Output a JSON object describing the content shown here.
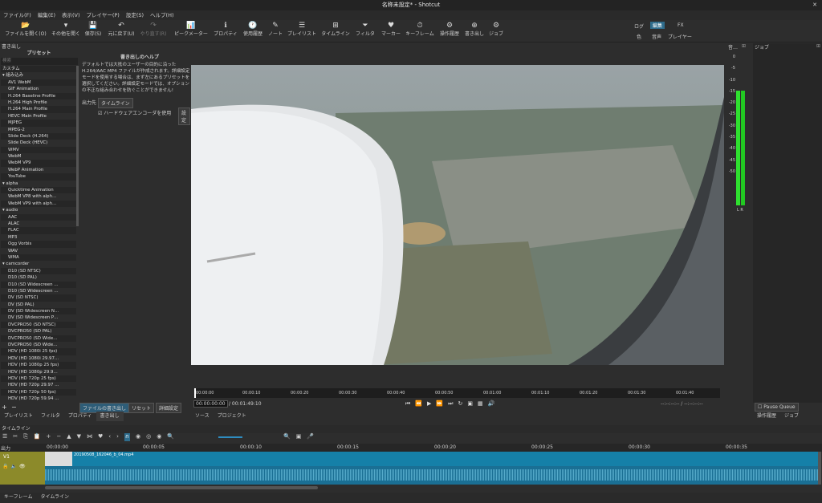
{
  "window": {
    "title": "名称未設定* - Shotcut",
    "close": "✕"
  },
  "menu": [
    "ファイル(F)",
    "編集(E)",
    "表示(V)",
    "プレイヤー(P)",
    "設定(S)",
    "ヘルプ(H)"
  ],
  "toolbar": [
    {
      "label": "ファイルを開く(O)",
      "icon": "📂"
    },
    {
      "label": "その他を開く",
      "icon": "▾"
    },
    {
      "label": "保存(S)",
      "icon": "💾"
    },
    {
      "label": "元に戻す(U)",
      "icon": "↶"
    },
    {
      "label": "やり直す(R)",
      "icon": "↷"
    },
    {
      "label": "ピークメーター",
      "icon": "📊"
    },
    {
      "label": "プロパティ",
      "icon": "ℹ"
    },
    {
      "label": "使用履歴",
      "icon": "🕐"
    },
    {
      "label": "ノート",
      "icon": "✎"
    },
    {
      "label": "プレイリスト",
      "icon": "☰"
    },
    {
      "label": "タイムライン",
      "icon": "⊞"
    },
    {
      "label": "フィルタ",
      "icon": "⏷"
    },
    {
      "label": "マーカー",
      "icon": "♥"
    },
    {
      "label": "キーフレーム",
      "icon": "⏱"
    },
    {
      "label": "操作履歴",
      "icon": "⚙"
    },
    {
      "label": "書き出し",
      "icon": "⊕"
    },
    {
      "label": "ジョブ",
      "icon": "⚙"
    }
  ],
  "layouts": {
    "log": "ログ",
    "edit": "編集",
    "fx": "FX",
    "color": "色",
    "audio": "音声",
    "player": "プレイヤー"
  },
  "export": {
    "panel_title": "書き出し",
    "undock": "⊞",
    "presets_header": "プリセット",
    "search_placeholder": "検索",
    "presets": [
      {
        "label": "カスタム",
        "level": 0
      },
      {
        "label": "▾ 組み込み",
        "level": 0
      },
      {
        "label": "AV1 WebM",
        "level": 1
      },
      {
        "label": "GIF Animation",
        "level": 1
      },
      {
        "label": "H.264 Baseline Profile",
        "level": 1
      },
      {
        "label": "H.264 High Profile",
        "level": 1
      },
      {
        "label": "H.264 Main Profile",
        "level": 1
      },
      {
        "label": "HEVC Main Profile",
        "level": 1
      },
      {
        "label": "MJPEG",
        "level": 1
      },
      {
        "label": "MPEG-2",
        "level": 1
      },
      {
        "label": "Slide Deck (H.264)",
        "level": 1
      },
      {
        "label": "Slide Deck (HEVC)",
        "level": 1
      },
      {
        "label": "WMV",
        "level": 1
      },
      {
        "label": "WebM",
        "level": 1
      },
      {
        "label": "WebM VP9",
        "level": 1
      },
      {
        "label": "WebP Animation",
        "level": 1
      },
      {
        "label": "YouTube",
        "level": 1
      },
      {
        "label": "▾ alpha",
        "level": 0
      },
      {
        "label": "Quicktime Animation",
        "level": 1
      },
      {
        "label": "WebM VP8 with alph…",
        "level": 1
      },
      {
        "label": "WebM VP9 with alph…",
        "level": 1
      },
      {
        "label": "▾ audio",
        "level": 0
      },
      {
        "label": "AAC",
        "level": 1
      },
      {
        "label": "ALAC",
        "level": 1
      },
      {
        "label": "FLAC",
        "level": 1
      },
      {
        "label": "MP3",
        "level": 1
      },
      {
        "label": "Ogg Vorbis",
        "level": 1
      },
      {
        "label": "WAV",
        "level": 1
      },
      {
        "label": "WMA",
        "level": 1
      },
      {
        "label": "▾ camcorder",
        "level": 0
      },
      {
        "label": "D10 (SD NTSC)",
        "level": 1
      },
      {
        "label": "D10 (SD PAL)",
        "level": 1
      },
      {
        "label": "D10 (SD Widescreen …",
        "level": 1
      },
      {
        "label": "D10 (SD Widescreen …",
        "level": 1
      },
      {
        "label": "DV (SD NTSC)",
        "level": 1
      },
      {
        "label": "DV (SD PAL)",
        "level": 1
      },
      {
        "label": "DV (SD Widescreen N…",
        "level": 1
      },
      {
        "label": "DV (SD Widescreen P…",
        "level": 1
      },
      {
        "label": "DVCPRO50 (SD NTSC)",
        "level": 1
      },
      {
        "label": "DVCPRO50 (SD PAL)",
        "level": 1
      },
      {
        "label": "DVCPRO50 (SD Wide…",
        "level": 1
      },
      {
        "label": "DVCPRO50 (SD Wide…",
        "level": 1
      },
      {
        "label": "HDV (HD 1080i 25 fps)",
        "level": 1
      },
      {
        "label": "HDV (HD 1080i 29.97…",
        "level": 1
      },
      {
        "label": "HDV (HD 1080p 25 fps)",
        "level": 1
      },
      {
        "label": "HDV (HD 1080p 29.9…",
        "level": 1
      },
      {
        "label": "HDV (HD 720p 25 fps)",
        "level": 1
      },
      {
        "label": "HDV (HD 720p 29.97 …",
        "level": 1
      },
      {
        "label": "HDV (HD 720p 50 fps)",
        "level": 1
      },
      {
        "label": "HDV (HD 720p 59.94 …",
        "level": 1
      }
    ],
    "add": "+",
    "remove": "−",
    "help_title": "書き出しのヘルプ",
    "help_text": "デフォルトでは大抵のユーザーの目的に沿った H.264/AAC MP4 ファイルが作成されます。詳細設定 モードを使用する場合は、まず左にあるプリセットを選択してください。詳細設定モードでは、オプションの不正な組み合わせを防ぐことができません!",
    "output_label": "出力先",
    "output_value": "タイムライン",
    "hw_encoder_label": "ハードウェアエンコーダを使用",
    "hw_config": "設定",
    "export_file_btn": "ファイルの書き出し",
    "reset_btn": "リセット",
    "advanced_btn": "詳細設定"
  },
  "left_tabs": [
    "プレイリスト",
    "フィルタ",
    "プロパティ",
    "書き出し"
  ],
  "player": {
    "ruler": [
      "00:00:00",
      "00:00:10",
      "00:00:20",
      "00:00:30",
      "00:00:40",
      "00:00:50",
      "00:01:00",
      "00:01:10",
      "00:01:20",
      "00:01:30",
      "00:01:40"
    ],
    "timecode": "00:00:00:00",
    "duration": "/ 00:01:49:10",
    "in_out": "--:--:--:-- / --:--:--:--",
    "tabs": [
      "ソース",
      "プロジェクト"
    ]
  },
  "meter": {
    "title": "音…",
    "undock": "⊞",
    "scale": [
      "0",
      "-5",
      "-10",
      "-15",
      "-20",
      "-25",
      "-30",
      "-35",
      "-40",
      "-45",
      "-50"
    ],
    "lr": "L R"
  },
  "jobs": {
    "title": "ジョブ",
    "undock": "⊞",
    "pause_label": "Pause Queue",
    "tabs": [
      "操作履歴",
      "ジョブ"
    ]
  },
  "timeline": {
    "title": "タイムライン",
    "ruler": [
      "00:00:00",
      "00:00:05",
      "00:00:10",
      "00:00:15",
      "00:00:20",
      "00:00:25",
      "00:00:30",
      "00:00:35"
    ],
    "output_label": "出力",
    "track_name": "V1",
    "clip_name": "20190508_162046_b_04.mp4"
  },
  "bottom_tabs": [
    "キーフレーム",
    "タイムライン"
  ]
}
